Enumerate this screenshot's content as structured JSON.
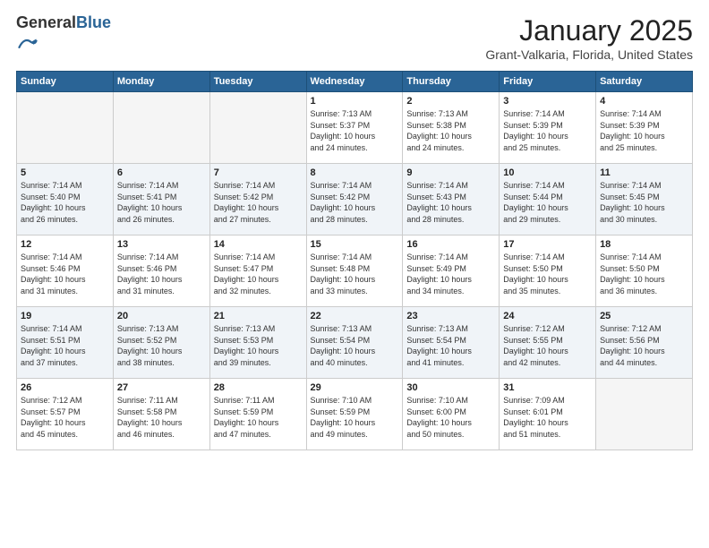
{
  "logo": {
    "general": "General",
    "blue": "Blue"
  },
  "title": "January 2025",
  "subtitle": "Grant-Valkaria, Florida, United States",
  "headers": [
    "Sunday",
    "Monday",
    "Tuesday",
    "Wednesday",
    "Thursday",
    "Friday",
    "Saturday"
  ],
  "weeks": [
    [
      {
        "day": "",
        "info": ""
      },
      {
        "day": "",
        "info": ""
      },
      {
        "day": "",
        "info": ""
      },
      {
        "day": "1",
        "info": "Sunrise: 7:13 AM\nSunset: 5:37 PM\nDaylight: 10 hours\nand 24 minutes."
      },
      {
        "day": "2",
        "info": "Sunrise: 7:13 AM\nSunset: 5:38 PM\nDaylight: 10 hours\nand 24 minutes."
      },
      {
        "day": "3",
        "info": "Sunrise: 7:14 AM\nSunset: 5:39 PM\nDaylight: 10 hours\nand 25 minutes."
      },
      {
        "day": "4",
        "info": "Sunrise: 7:14 AM\nSunset: 5:39 PM\nDaylight: 10 hours\nand 25 minutes."
      }
    ],
    [
      {
        "day": "5",
        "info": "Sunrise: 7:14 AM\nSunset: 5:40 PM\nDaylight: 10 hours\nand 26 minutes."
      },
      {
        "day": "6",
        "info": "Sunrise: 7:14 AM\nSunset: 5:41 PM\nDaylight: 10 hours\nand 26 minutes."
      },
      {
        "day": "7",
        "info": "Sunrise: 7:14 AM\nSunset: 5:42 PM\nDaylight: 10 hours\nand 27 minutes."
      },
      {
        "day": "8",
        "info": "Sunrise: 7:14 AM\nSunset: 5:42 PM\nDaylight: 10 hours\nand 28 minutes."
      },
      {
        "day": "9",
        "info": "Sunrise: 7:14 AM\nSunset: 5:43 PM\nDaylight: 10 hours\nand 28 minutes."
      },
      {
        "day": "10",
        "info": "Sunrise: 7:14 AM\nSunset: 5:44 PM\nDaylight: 10 hours\nand 29 minutes."
      },
      {
        "day": "11",
        "info": "Sunrise: 7:14 AM\nSunset: 5:45 PM\nDaylight: 10 hours\nand 30 minutes."
      }
    ],
    [
      {
        "day": "12",
        "info": "Sunrise: 7:14 AM\nSunset: 5:46 PM\nDaylight: 10 hours\nand 31 minutes."
      },
      {
        "day": "13",
        "info": "Sunrise: 7:14 AM\nSunset: 5:46 PM\nDaylight: 10 hours\nand 31 minutes."
      },
      {
        "day": "14",
        "info": "Sunrise: 7:14 AM\nSunset: 5:47 PM\nDaylight: 10 hours\nand 32 minutes."
      },
      {
        "day": "15",
        "info": "Sunrise: 7:14 AM\nSunset: 5:48 PM\nDaylight: 10 hours\nand 33 minutes."
      },
      {
        "day": "16",
        "info": "Sunrise: 7:14 AM\nSunset: 5:49 PM\nDaylight: 10 hours\nand 34 minutes."
      },
      {
        "day": "17",
        "info": "Sunrise: 7:14 AM\nSunset: 5:50 PM\nDaylight: 10 hours\nand 35 minutes."
      },
      {
        "day": "18",
        "info": "Sunrise: 7:14 AM\nSunset: 5:50 PM\nDaylight: 10 hours\nand 36 minutes."
      }
    ],
    [
      {
        "day": "19",
        "info": "Sunrise: 7:14 AM\nSunset: 5:51 PM\nDaylight: 10 hours\nand 37 minutes."
      },
      {
        "day": "20",
        "info": "Sunrise: 7:13 AM\nSunset: 5:52 PM\nDaylight: 10 hours\nand 38 minutes."
      },
      {
        "day": "21",
        "info": "Sunrise: 7:13 AM\nSunset: 5:53 PM\nDaylight: 10 hours\nand 39 minutes."
      },
      {
        "day": "22",
        "info": "Sunrise: 7:13 AM\nSunset: 5:54 PM\nDaylight: 10 hours\nand 40 minutes."
      },
      {
        "day": "23",
        "info": "Sunrise: 7:13 AM\nSunset: 5:54 PM\nDaylight: 10 hours\nand 41 minutes."
      },
      {
        "day": "24",
        "info": "Sunrise: 7:12 AM\nSunset: 5:55 PM\nDaylight: 10 hours\nand 42 minutes."
      },
      {
        "day": "25",
        "info": "Sunrise: 7:12 AM\nSunset: 5:56 PM\nDaylight: 10 hours\nand 44 minutes."
      }
    ],
    [
      {
        "day": "26",
        "info": "Sunrise: 7:12 AM\nSunset: 5:57 PM\nDaylight: 10 hours\nand 45 minutes."
      },
      {
        "day": "27",
        "info": "Sunrise: 7:11 AM\nSunset: 5:58 PM\nDaylight: 10 hours\nand 46 minutes."
      },
      {
        "day": "28",
        "info": "Sunrise: 7:11 AM\nSunset: 5:59 PM\nDaylight: 10 hours\nand 47 minutes."
      },
      {
        "day": "29",
        "info": "Sunrise: 7:10 AM\nSunset: 5:59 PM\nDaylight: 10 hours\nand 49 minutes."
      },
      {
        "day": "30",
        "info": "Sunrise: 7:10 AM\nSunset: 6:00 PM\nDaylight: 10 hours\nand 50 minutes."
      },
      {
        "day": "31",
        "info": "Sunrise: 7:09 AM\nSunset: 6:01 PM\nDaylight: 10 hours\nand 51 minutes."
      },
      {
        "day": "",
        "info": ""
      }
    ]
  ]
}
